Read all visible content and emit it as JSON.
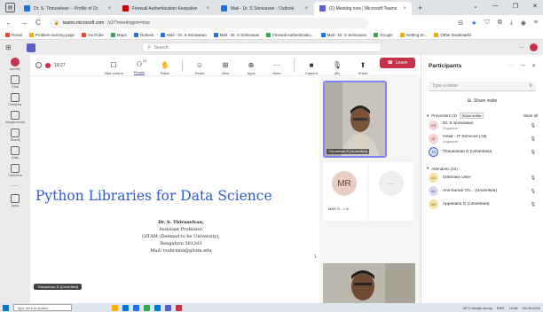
{
  "browser": {
    "tabs": [
      {
        "label": "Dr. S. Thiruselvan -- Profile of Dr. ",
        "active": false,
        "favicon": "blue"
      },
      {
        "label": "Firewall Authentication Keepalive",
        "active": false,
        "favicon": "red"
      },
      {
        "label": "Mail - Dr. S Srinivasan - Outlook",
        "active": false,
        "favicon": "blue"
      },
      {
        "label": "(2) Meeting now | Microsoft Teams",
        "active": true,
        "favicon": "teams"
      }
    ],
    "tab_close": "×",
    "new_tab": "+",
    "window_controls": [
      "⌄",
      "—",
      "❐",
      "✕"
    ],
    "url_host": "teams.microsoft.com",
    "url_path": "/v2/?meetingjoin=true",
    "nav": [
      "←",
      "→",
      "C"
    ],
    "bookmarks": [
      {
        "label": "Gmail",
        "color": "r"
      },
      {
        "label": "Problem-Solving page",
        "color": "y"
      },
      {
        "label": "YouTube",
        "color": "r"
      },
      {
        "label": "Maps",
        "color": "g"
      },
      {
        "label": "Outlook",
        "color": "b"
      },
      {
        "label": "Mail - Dr. S Srinivasan",
        "color": "b"
      },
      {
        "label": "Mail - Dr. S Srinivasan",
        "color": "b"
      },
      {
        "label": "Firewall Authenticatio...",
        "color": "g"
      },
      {
        "label": "Mail - Dr. S Srinivasan",
        "color": "b"
      },
      {
        "label": "Google",
        "color": "g"
      },
      {
        "label": "Getting St...",
        "color": "y"
      },
      {
        "label": "Other Bookmarks",
        "color": "y"
      }
    ]
  },
  "teams": {
    "search_placeholder": "Search",
    "top_right_more": "···",
    "rail": [
      {
        "label": "Activity",
        "active": true
      },
      {
        "label": "Chat",
        "active": false
      },
      {
        "label": "Calendar",
        "active": false
      },
      {
        "label": "Assignments",
        "active": false
      },
      {
        "label": "Teams",
        "active": false
      },
      {
        "label": "Calls",
        "active": false
      },
      {
        "label": "OneDrive",
        "active": false
      },
      {
        "label": "Apps",
        "active": false
      }
    ],
    "rail_more": "···"
  },
  "meeting": {
    "timer": "19:27",
    "controls": [
      {
        "label": "Take control",
        "glyph": "☐"
      },
      {
        "label": "People",
        "glyph": "⚇",
        "badge": "10",
        "active": true
      },
      {
        "label": "Raise",
        "glyph": "✋"
      },
      {
        "label": "React",
        "glyph": "☺"
      },
      {
        "label": "View",
        "glyph": "⊞"
      },
      {
        "label": "Apps",
        "glyph": "⊕"
      },
      {
        "label": "More",
        "glyph": "···"
      },
      {
        "label": "Camera",
        "glyph": "■"
      },
      {
        "label": "Mic",
        "glyph": "🎙"
      },
      {
        "label": "Share",
        "glyph": "⬆"
      }
    ],
    "leave_label": "Leave",
    "slide": {
      "title": "Python Libraries for Data Science",
      "presenter_name": "Dr. S. Thiruselvan,",
      "lines": [
        "Assistant Professor,",
        "GITAM (Deemed to be University),",
        "Bengaluru 561203",
        "Mail: tsubrama@gitam.edu"
      ],
      "page_number": "1"
    },
    "presenter_tag": "Thiruselvan S (Unverified)",
    "video_tag": "Thiruselvan S (Unverified)",
    "mr_initials": "MR",
    "mr_label": "MAR S...",
    "dots_tile": "···"
  },
  "participants": {
    "title": "Participants",
    "header_controls": [
      "···",
      "—",
      "✕"
    ],
    "search_placeholder": "Type a name",
    "share_invite": "Share invite",
    "presenters_section": "Presenters (3)",
    "presenters_tooltip": "Show in title",
    "mute_all": "Mute all",
    "presenters": [
      {
        "initials": "DS",
        "name": "Dr. S Srinivasan",
        "role": "Organizer",
        "color": "pink"
      },
      {
        "initials": "HI",
        "name": "Head - IT Services (All)",
        "role": "Organizer",
        "color": "rose"
      },
      {
        "initials": "TS",
        "name": "Thiruselvan S (Unverified)",
        "role": "",
        "color": "blue"
      }
    ],
    "attendees_section": "Attendees (10)",
    "attendees": [
      {
        "initials": "UU",
        "name": "Unknown User",
        "color": "yel"
      },
      {
        "initials": "AC",
        "name": "Anil Kumar Ch... (Unverified)",
        "color": "lav"
      },
      {
        "initials": "AG",
        "name": "Appasami G (Unverified)",
        "color": "yel"
      }
    ]
  },
  "taskbar": {
    "search_placeholder": "Type here to search",
    "weather": "29°C  Mostly sunny",
    "lang": "ENG",
    "time": "10:58",
    "date": "04-03-2024",
    "icon_colors": [
      "#f9ab00",
      "#0078d4",
      "#1a73e8",
      "#34a853",
      "#0078d4",
      "#5b5fc7",
      "#c4314b"
    ]
  }
}
